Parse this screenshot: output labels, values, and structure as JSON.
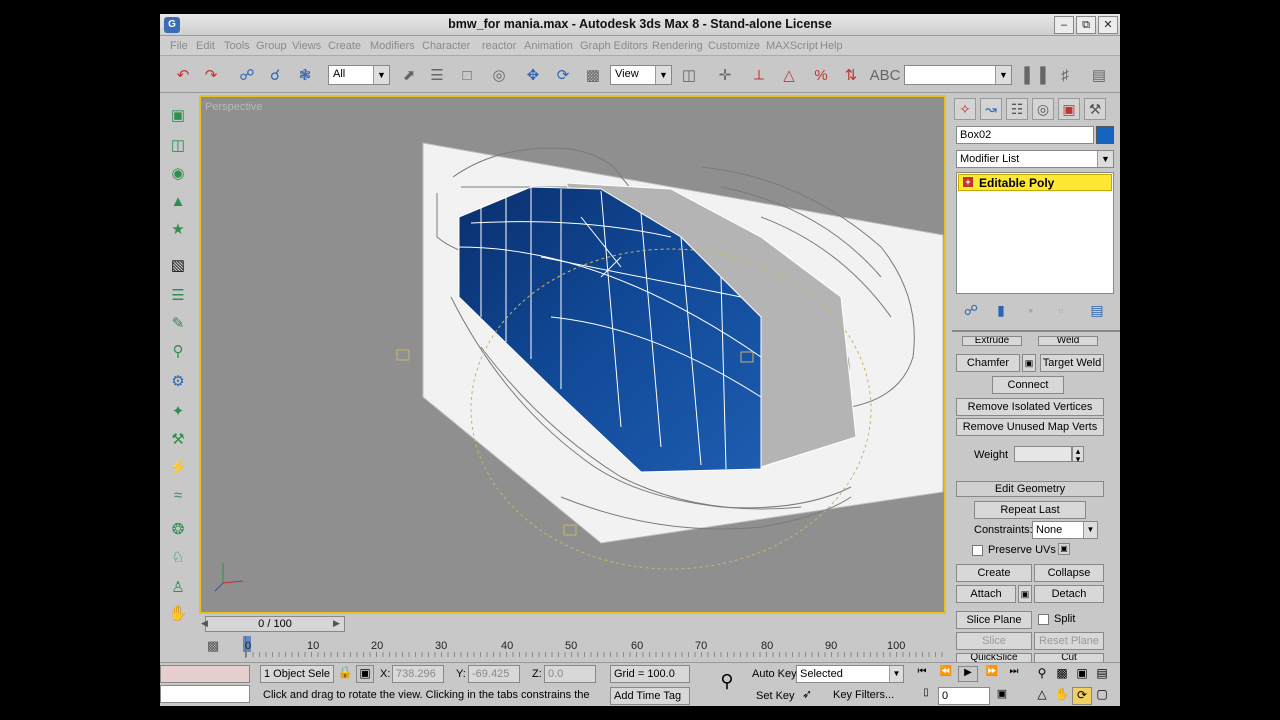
{
  "window": {
    "title": "bmw_for mania.max - Autodesk 3ds Max 8 - Stand-alone License",
    "app_icon": "G",
    "minimize": "–",
    "restore": "⧉",
    "close": "✕"
  },
  "menu": [
    "File",
    "Edit",
    "Tools",
    "Group",
    "Views",
    "Create",
    "Modifiers",
    "Character",
    "reactor",
    "Animation",
    "Graph Editors",
    "Rendering",
    "Customize",
    "MAXScript",
    "Help"
  ],
  "toolbar": {
    "selection_filter": "All",
    "ref_coord": "View",
    "named_selection": ""
  },
  "viewport": {
    "label": "Perspective"
  },
  "command_panel": {
    "object_name": "Box02",
    "object_color": "#1565c0",
    "modifier_list": "Modifier List",
    "stack_item": "Editable Poly",
    "buttons": {
      "extrude": "Extrude",
      "weld": "Weld",
      "chamfer": "Chamfer",
      "target_weld": "Target Weld",
      "connect": "Connect",
      "remove_isolated": "Remove Isolated Vertices",
      "remove_unused": "Remove Unused Map Verts",
      "weight_label": "Weight",
      "edit_geometry": "Edit Geometry",
      "repeat_last": "Repeat Last",
      "constraints_label": "Constraints:",
      "constraints_value": "None",
      "preserve_uvs": "Preserve UVs",
      "create": "Create",
      "collapse": "Collapse",
      "attach": "Attach",
      "detach": "Detach",
      "slice_plane": "Slice Plane",
      "split": "Split",
      "slice": "Slice",
      "reset_plane": "Reset Plane",
      "quickslice": "QuickSlice",
      "cut": "Cut"
    }
  },
  "timeline": {
    "slider": "0 / 100",
    "ticks": [
      "0",
      "10",
      "20",
      "30",
      "40",
      "50",
      "60",
      "70",
      "80",
      "90",
      "100"
    ]
  },
  "status": {
    "selection": "1 Object Sele",
    "x_label": "X:",
    "x_value": "738.296",
    "y_label": "Y:",
    "y_value": "-69.425",
    "z_label": "Z:",
    "z_value": "0.0",
    "grid": "Grid = 100.0",
    "prompt": "Click and drag to rotate the view.  Clicking in the tabs constrains the rotation",
    "add_time_tag": "Add Time Tag",
    "auto_key": "Auto Key",
    "set_key": "Set Key",
    "key_mode": "Selected",
    "key_filters": "Key Filters...",
    "frame": "0"
  }
}
